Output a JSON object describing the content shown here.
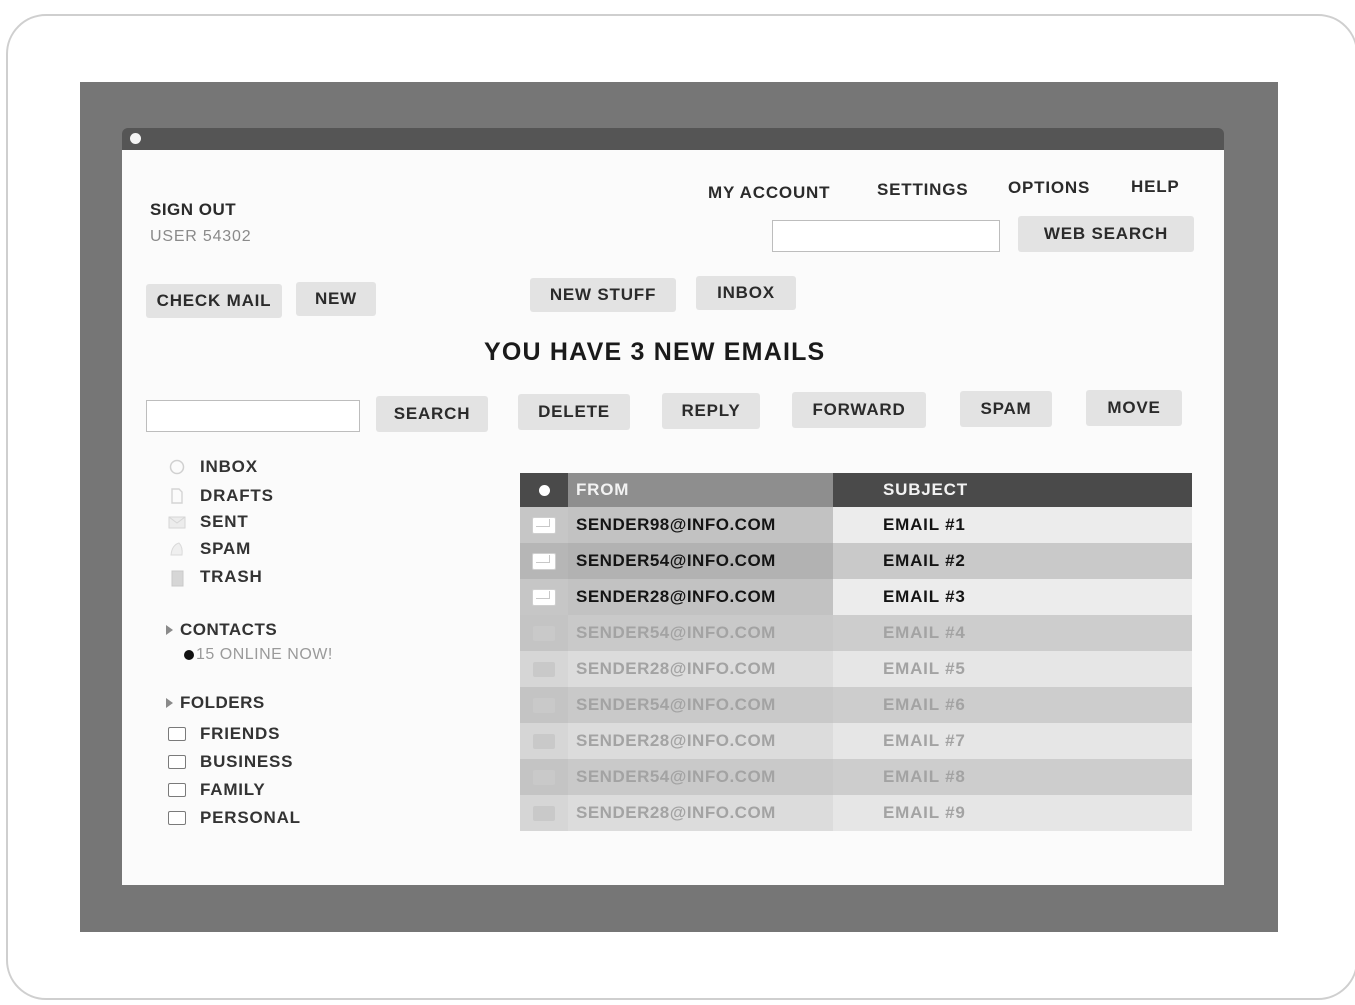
{
  "header": {
    "sign_out": "SIGN OUT",
    "user": "USER 54302",
    "nav": [
      "MY ACCOUNT",
      "SETTINGS",
      "OPTIONS",
      "HELP"
    ],
    "web_search_label": "WEB SEARCH",
    "web_search_value": ""
  },
  "toolbar": {
    "check_mail": "CHECK MAIL",
    "new": "NEW",
    "new_stuff": "NEW STUFF",
    "inbox": "INBOX"
  },
  "banner": "YOU HAVE 3 NEW EMAILS",
  "actions": {
    "search_value": "",
    "search": "SEARCH",
    "delete": "DELETE",
    "reply": "REPLY",
    "forward": "FORWARD",
    "spam": "SPAM",
    "move": "MOVE"
  },
  "sidebar": {
    "mailboxes": [
      {
        "label": "INBOX",
        "icon": "inbox-icon"
      },
      {
        "label": "DRAFTS",
        "icon": "drafts-icon"
      },
      {
        "label": "SENT",
        "icon": "sent-icon"
      },
      {
        "label": "SPAM",
        "icon": "spam-icon"
      },
      {
        "label": "TRASH",
        "icon": "trash-icon"
      }
    ],
    "contacts_title": "CONTACTS",
    "contacts_online": "15 ONLINE NOW!",
    "folders_title": "FOLDERS",
    "folders": [
      "FRIENDS",
      "BUSINESS",
      "FAMILY",
      "PERSONAL"
    ]
  },
  "table": {
    "columns": [
      "FROM",
      "SUBJECT"
    ],
    "rows": [
      {
        "from": "SENDER98@INFO.COM",
        "subject": "EMAIL #1",
        "unread": true
      },
      {
        "from": "SENDER54@INFO.COM",
        "subject": "EMAIL #2",
        "unread": true
      },
      {
        "from": "SENDER28@INFO.COM",
        "subject": "EMAIL #3",
        "unread": true
      },
      {
        "from": "SENDER54@INFO.COM",
        "subject": "EMAIL #4",
        "unread": false
      },
      {
        "from": "SENDER28@INFO.COM",
        "subject": "EMAIL #5",
        "unread": false
      },
      {
        "from": "SENDER54@INFO.COM",
        "subject": "EMAIL #6",
        "unread": false
      },
      {
        "from": "SENDER28@INFO.COM",
        "subject": "EMAIL #7",
        "unread": false
      },
      {
        "from": "SENDER54@INFO.COM",
        "subject": "EMAIL #8",
        "unread": false
      },
      {
        "from": "SENDER28@INFO.COM",
        "subject": "EMAIL #9",
        "unread": false
      }
    ]
  },
  "colors": {
    "bezel": "#767676",
    "header_dark": "#4a4a4a",
    "header_mid": "#8e8e8e",
    "button_bg": "#e3e3e3"
  }
}
